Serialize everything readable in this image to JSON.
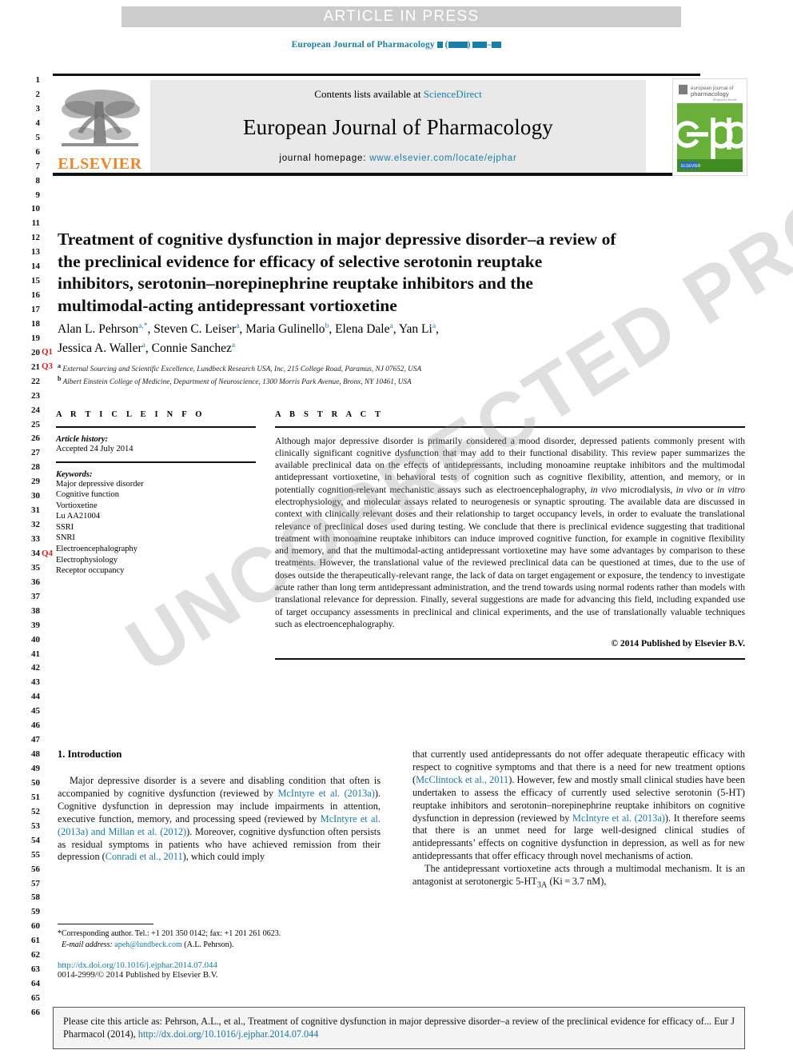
{
  "banner": {
    "text": "ARTICLE IN PRESS"
  },
  "running_head": {
    "journal": "European Journal of Pharmacology"
  },
  "masthead": {
    "contents_prefix": "Contents lists available at ",
    "contents_link": "ScienceDirect",
    "journal_title": "European Journal of Pharmacology",
    "homepage_label": "journal homepage: ",
    "homepage_url": "www.elsevier.com/locate/ejphar",
    "publisher_wordmark": "ELSEVIER",
    "cover_line1": "european journal of",
    "cover_line2": "pharmacology",
    "cover_line3": "Bergische Straße",
    "cover_logo_text": "ejp"
  },
  "article": {
    "title": "Treatment of cognitive dysfunction in major depressive disorder–a review of the preclinical evidence for efficacy of selective serotonin reuptake inhibitors, serotonin–norepinephrine reuptake inhibitors and the multimodal-acting antidepressant vortioxetine",
    "authors": "Alan L. Pehrson a,*, Steven C. Leiser a, Maria Gulinello b, Elena Dale a, Yan Li a, Jessica A. Waller a, Connie Sanchez a",
    "affiliation_a": "External Sourcing and Scientific Excellence, Lundbeck Research USA, Inc, 215 College Road, Paramus, NJ 07652, USA",
    "affiliation_b": "Albert Einstein College of Medicine, Department of Neuroscience, 1300 Morris Park Avenue, Bronx, NY 10461, USA"
  },
  "article_info": {
    "heading": "A R T I C L E  I N F O",
    "history_label": "Article history:",
    "history_value": "Accepted 24 July 2014",
    "keywords_label": "Keywords:",
    "keywords": [
      "Major depressive disorder",
      "Cognitive function",
      "Vortioxetine",
      "Lu AA21004",
      "SSRI",
      "SNRI",
      "Electroencephalography",
      "Electrophysiology",
      "Receptor occupancy"
    ]
  },
  "abstract": {
    "heading": "A B S T R A C T",
    "paragraph_1": "Although major depressive disorder is primarily considered a mood disorder, depressed patients commonly present with clinically significant cognitive dysfunction that may add to their functional disability. This review paper summarizes the available preclinical data on the effects of antidepressants, including monoamine reuptake inhibitors and the multimodal antidepressant vortioxetine, in behavioral tests of cognition such as cognitive flexibility, attention, and memory, or in potentially cognition-relevant mechanistic assays such as electroencephalography, ",
    "italic_1": "in vivo",
    "paragraph_2": " microdialysis, ",
    "italic_2": "in vivo",
    "paragraph_3": " or ",
    "italic_3": "in vitro",
    "paragraph_4": " electrophysiology, and molecular assays related to neurogenesis or synaptic sprouting. The available data are discussed in context with clinically relevant doses and their relationship to target occupancy levels, in order to evaluate the translational relevance of preclinical doses used during testing. We conclude that there is preclinical evidence suggesting that traditional treatment with monoamine reuptake inhibitors can induce improved cognitive function, for example in cognitive flexibility and memory, and that the multimodal-acting antidepressant vortioxetine may have some advantages by comparison to these treatments. However, the translational value of the reviewed preclinical data can be questioned at times, due to the use of doses outside the therapeutically-relevant range, the lack of data on target engagement or exposure, the tendency to investigate acute rather than long term antidepressant administration, and the trend towards using normal rodents rather than models with translational relevance for depression. Finally, several suggestions are made for advancing this field, including expanded use of target occupancy assessments in preclinical and clinical experiments, and the use of translationally valuable techniques such as electroencephalography.",
    "copyright": "© 2014 Published by Elsevier B.V."
  },
  "introduction": {
    "heading": "1.  Introduction",
    "left_p1_a": "Major depressive disorder is a severe and disabling condition that often is accompanied by cognitive dysfunction (reviewed by ",
    "left_ref1": "McIntyre et al. (2013a)",
    "left_p1_b": "). Cognitive dysfunction in depression may include impairments in attention, executive function, memory, and processing speed (reviewed by ",
    "left_ref2": "McIntyre et al. (2013a) and Millan et al. (2012)",
    "left_p1_c": "). Moreover, cognitive dysfunction often persists as residual symptoms in patients who have achieved remission from their depression (",
    "left_ref3": "Conradi et al., 2011",
    "left_p1_d": "), which could imply",
    "right_p1_a": "that currently used antidepressants do not offer adequate therapeutic efficacy with respect to cognitive symptoms and that there is a need for new treatment options (",
    "right_ref1": "McClintock et al., 2011",
    "right_p1_b": "). However, few and mostly small clinical studies have been undertaken to assess the efficacy of currently used selective serotonin (5-HT) reuptake inhibitors and serotonin–norepinephrine reuptake inhibitors on cognitive dysfunction in depression (reviewed by ",
    "right_ref2": "McIntyre et al. (2013a)",
    "right_p1_c": "). It therefore seems that there is an unmet need for large well-designed clinical studies of antidepressants’ effects on cognitive dysfunction in depression, as well as for new antidepressants that offer efficacy through novel mechanisms of action.",
    "right_p2_a": "The antidepressant vortioxetine acts through a multimodal mechanism. It is an antagonist at serotonergic 5-HT",
    "right_p2_sub": "3A",
    "right_p2_b": " (Ki = 3.7 nM),"
  },
  "footnote": {
    "corresponding": "*Corresponding author. Tel.: +1 201 350 0142; fax: +1 201 261 0623.",
    "email_label": "E-mail address:",
    "email": "apeh@lundbeck.com",
    "email_suffix": "(A.L. Pehrson).",
    "doi": "http://dx.doi.org/10.1016/j.ejphar.2014.07.044",
    "issn": "0014-2999/© 2014 Published by Elsevier B.V."
  },
  "citation_box": {
    "text_a": "Please cite this article as: Pehrson, A.L., et al., Treatment of cognitive dysfunction in major depressive disorder–a review of the preclinical evidence for efficacy of... Eur J Pharmacol (2014), ",
    "link": "http://dx.doi.org/10.1016/j.ejphar.2014.07.044"
  },
  "query_marks": {
    "q1": "Q1",
    "q3": "Q3",
    "q4": "Q4"
  },
  "watermark": {
    "text": "UNCORRECTED PROOF"
  },
  "line_numbers": {
    "first": 1,
    "last": 66
  },
  "colors": {
    "link": "#1579a5",
    "elsevier_orange": "#ee8622",
    "banner_grey": "#cccccc",
    "query_red": "#e01b1b",
    "cover_green": "#5aa832"
  }
}
